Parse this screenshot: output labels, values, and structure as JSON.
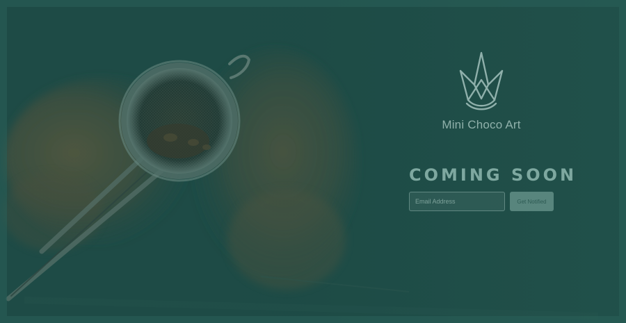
{
  "brand": {
    "name": "Mini Choco Art",
    "logo_icon": "crown-icon"
  },
  "hero": {
    "headline": "COMING SOON",
    "background_image": "cocoa-powder-sieve"
  },
  "signup": {
    "email_placeholder": "Email Address",
    "email_value": "",
    "button_label": "Get Notified"
  },
  "colors": {
    "overlay": "#1f4f4a",
    "text": "#8fb0ab",
    "button": "#58857d"
  }
}
